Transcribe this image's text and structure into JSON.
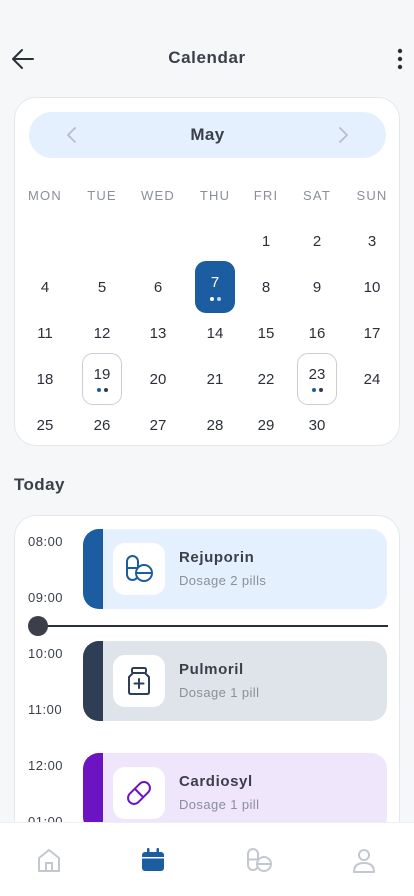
{
  "header": {
    "title": "Calendar",
    "back_icon": "arrow-left-icon",
    "more_icon": "more-vertical-icon"
  },
  "calendar": {
    "month": "May",
    "weekdays": [
      "MON",
      "TUE",
      "WED",
      "THU",
      "FRI",
      "SAT",
      "SUN"
    ],
    "rows": [
      [
        "",
        "",
        "",
        "",
        "1",
        "2",
        "3"
      ],
      [
        "4",
        "5",
        "6",
        "7",
        "8",
        "9",
        "10"
      ],
      [
        "11",
        "12",
        "13",
        "14",
        "15",
        "16",
        "17"
      ],
      [
        "18",
        "19",
        "20",
        "21",
        "22",
        "23",
        "24"
      ],
      [
        "25",
        "26",
        "27",
        "28",
        "29",
        "30",
        ""
      ]
    ],
    "selected_day": "7",
    "marked_days": [
      "19",
      "23"
    ]
  },
  "today": {
    "title": "Today",
    "times": [
      "08:00",
      "09:00",
      "10:00",
      "11:00",
      "12:00",
      "01:00"
    ],
    "medications": [
      {
        "name": "Rejuporin",
        "dosage": "Dosage 2 pills",
        "icon": "pills-icon",
        "color": "#1b5da0"
      },
      {
        "name": "Pulmoril",
        "dosage": "Dosage 1 pill",
        "icon": "medicine-bottle-icon",
        "color": "#2e3e55"
      },
      {
        "name": "Cardiosyl",
        "dosage": "Dosage 1 pill",
        "icon": "capsule-icon",
        "color": "#6c13c2"
      }
    ]
  },
  "nav": {
    "items": [
      {
        "icon": "home-icon",
        "active": false
      },
      {
        "icon": "calendar-icon",
        "active": true
      },
      {
        "icon": "pills-icon",
        "active": false
      },
      {
        "icon": "profile-icon",
        "active": false
      }
    ],
    "active_color": "#1b5da0",
    "inactive_color": "#c3c8d0"
  }
}
